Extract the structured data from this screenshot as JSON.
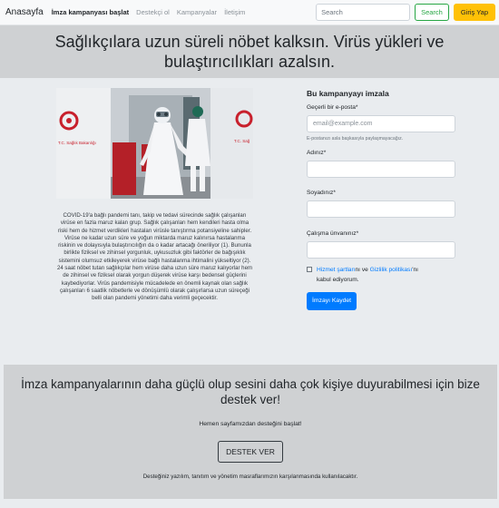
{
  "nav": {
    "brand": "Anasayfa",
    "links": [
      "İmza kampanyası başlat",
      "Destekçi ol",
      "Kampanyalar",
      "İletişim"
    ],
    "search_placeholder": "Search",
    "search_button": "Search",
    "login_button": "Giriş Yap"
  },
  "campaign": {
    "title": "Sağlıkçılara uzun süreli nöbet kalksın. Virüs yükleri ve bulaştırıcılıkları azalsın.",
    "photo_sign_left": "T.C. Sağlık Bakanlığı",
    "photo_sign_right": "T.C. Sağ",
    "story": "COVID-19'a bağlı pandemi tanı, takip ve tedavi sürecinde sağlık çalışanları virüse en fazla maruz kalan grup. Sağlık çalışanları hem kendileri hasta olma riski hem de hizmet verdikleri hastaları virüsle tanıştırma potansiyeline sahipler. Virüse ne kadar uzun süre ve yoğun miktarda maruz kalınırsa hastalanma riskinin ve dolayısıyla bulaştırıcılığın da o kadar artacağı öneriliyor (1). Bununla birlikte fiziksel ve zihinsel yorgunluk, uykusuzluk gibi faktörler de bağışıklık sistemini olumsuz etkileyerek virüse bağlı hastalanma ihtimalini yükseltiyor (2). 24 saat nöbet tutan sağlıkçılar hem virüse daha uzun süre maruz kalıyorlar hem de zihinsel ve fiziksel olarak yorgun düşerek virüse karşı bedensel güçlerini kaybediyorlar. Virüs pandemisiyle mücadelede en önemli kaynak olan sağlık çalışanları 6 saatlik nöbetlerle ve dönüşümlü olarak çalışırlarsa uzun süreçeği belli olan pandemi yönetimi daha verimli geçecektir."
  },
  "form": {
    "title": "Bu kampanyayı imzala",
    "email_label": "Geçerli bir e-posta*",
    "email_placeholder": "email@example.com",
    "email_hint": "E-postanızı asla başkasıyla paylaşmayacağız.",
    "name_label": "Adınız*",
    "surname_label": "Soyadınız*",
    "title_label": "Çalışma ünvanınız*",
    "terms_link": "Hizmet şartları",
    "terms_and": "nı ve",
    "privacy_link": "Gizlilik politikası",
    "terms_suffix": "'nı",
    "terms_accept": "kabul ediyorum.",
    "submit": "İmzayı Kaydet"
  },
  "support": {
    "heading": "İmza kampanyalarının daha güçlü olup sesini daha çok kişiye duyurabilmesi için bize destek ver!",
    "start_text": "Hemen sayfamızdan desteğini başlat!",
    "button": "DESTEK VER",
    "note": "Desteğiniz yazılım, tanıtım ve yönetim masraflarımızın karşılanmasında kullanılacaktır."
  }
}
